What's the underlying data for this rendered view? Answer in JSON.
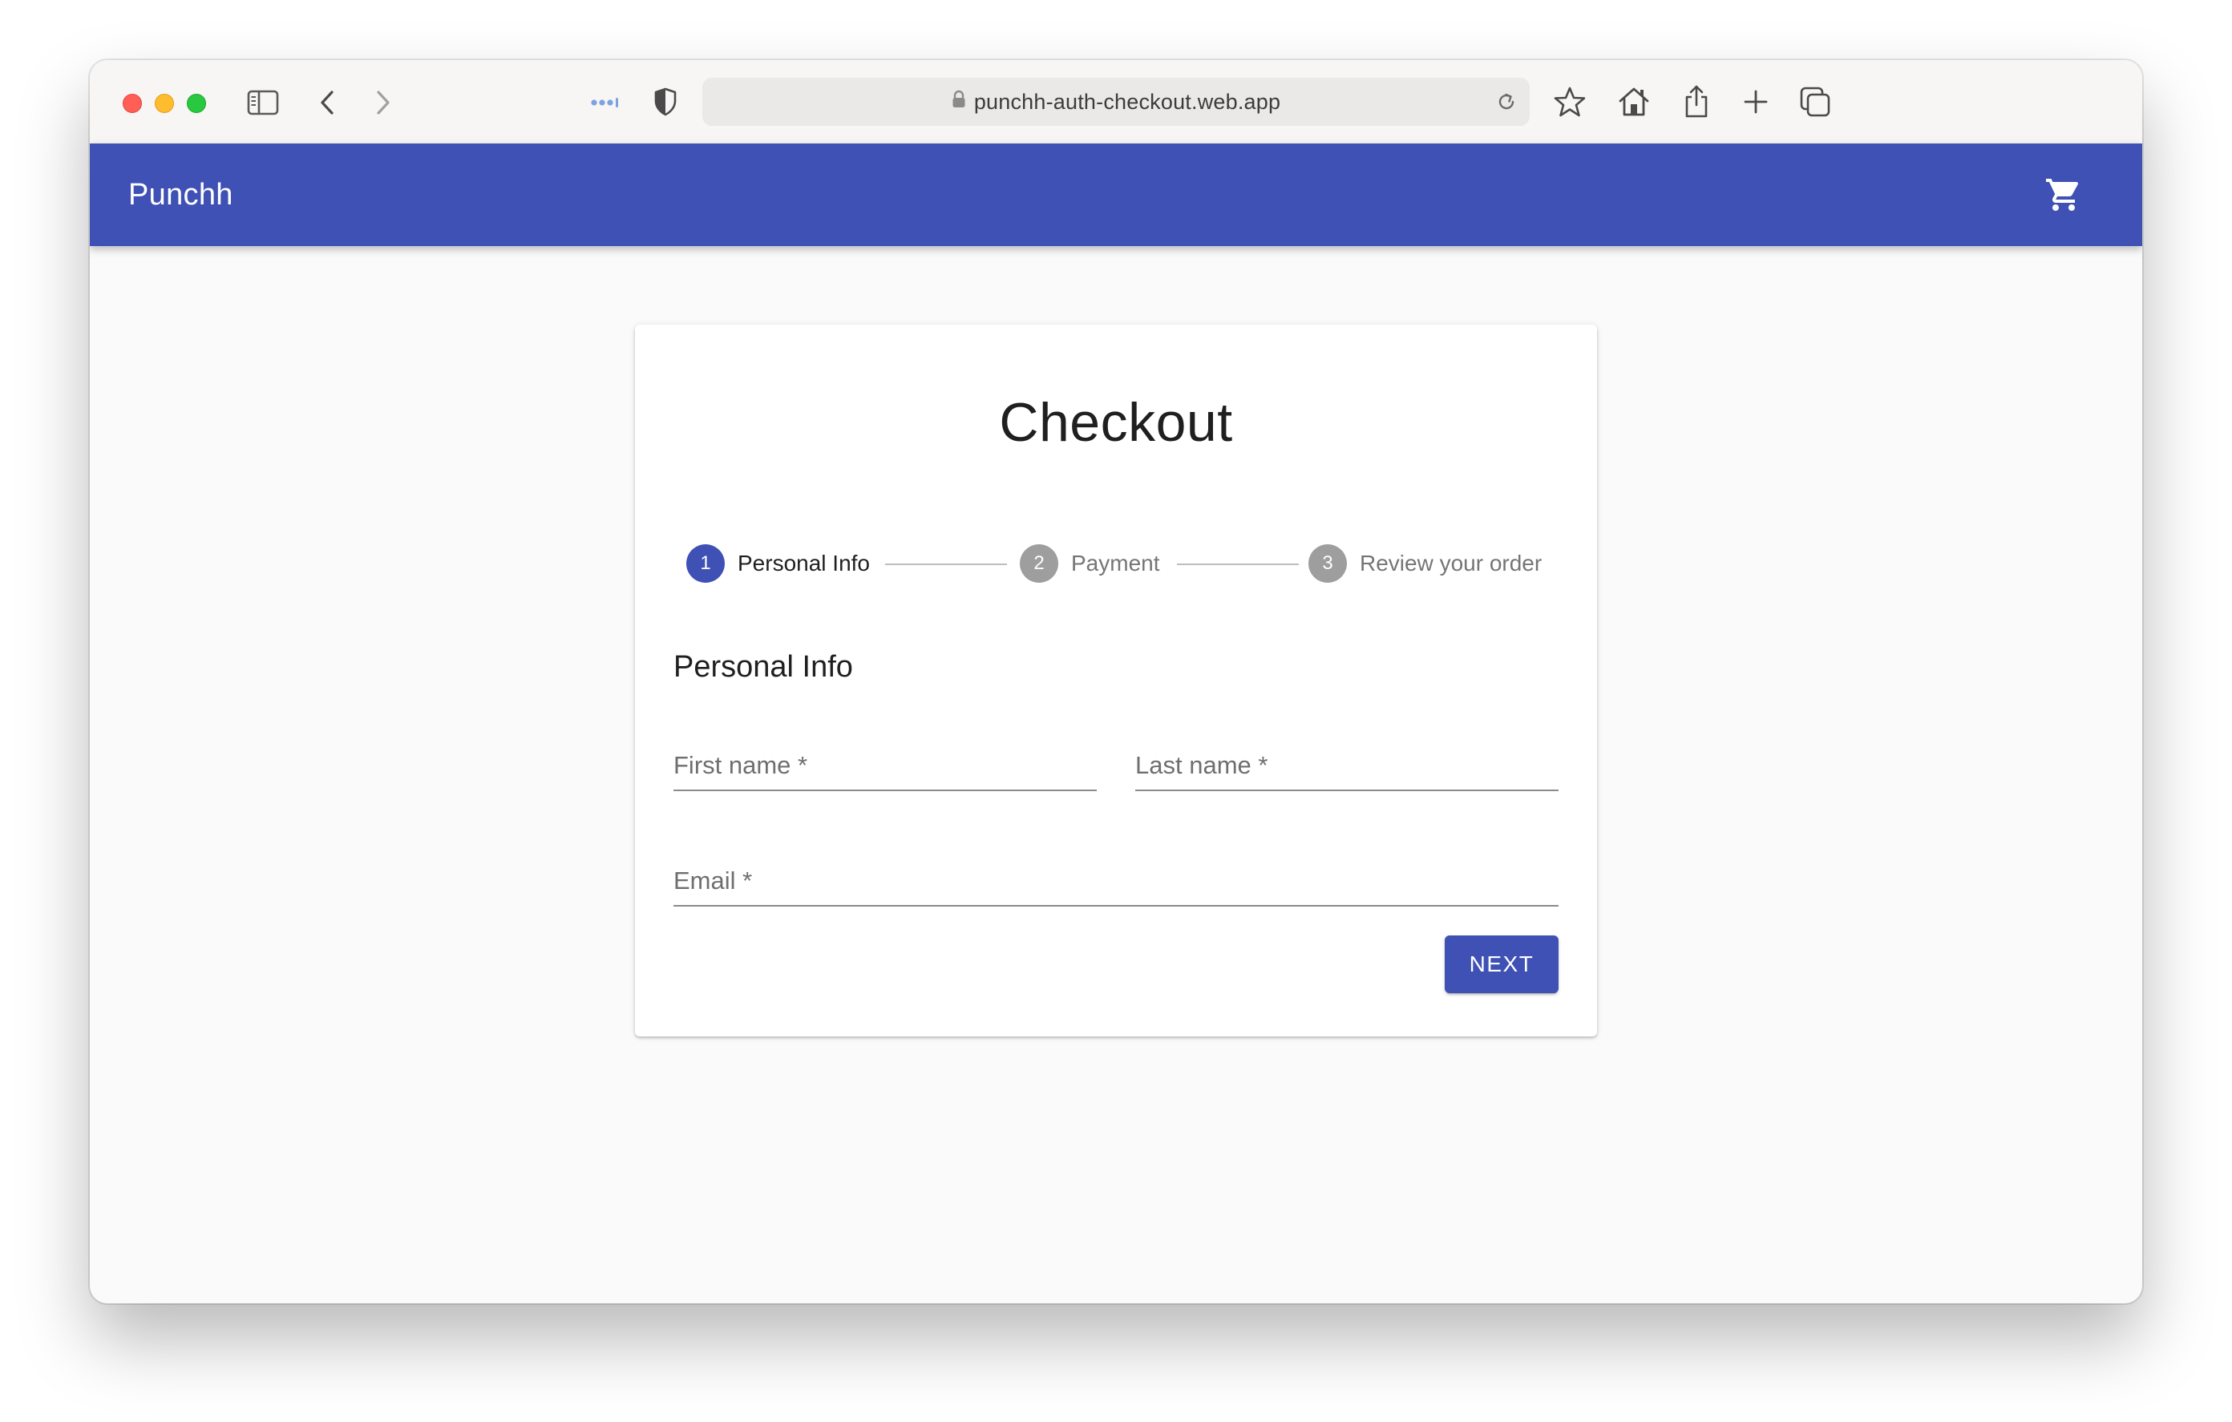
{
  "browser": {
    "url": "punchh-auth-checkout.web.app",
    "icons": [
      "sidebar-icon",
      "back-icon",
      "forward-icon",
      "tab-dots-icon",
      "shield-icon",
      "lock-icon",
      "reload-icon",
      "star-icon",
      "home-icon",
      "share-icon",
      "plus-icon",
      "tabs-icon"
    ]
  },
  "app_bar": {
    "title": "Punchh",
    "cart_icon": "shopping-cart-icon",
    "background": "#3f51b5"
  },
  "checkout": {
    "title": "Checkout",
    "steps": [
      {
        "number": "1",
        "label": "Personal Info",
        "state": "active"
      },
      {
        "number": "2",
        "label": "Payment",
        "state": "inactive"
      },
      {
        "number": "3",
        "label": "Review your order",
        "state": "inactive"
      }
    ],
    "section_title": "Personal Info",
    "fields": {
      "first_name": {
        "label": "First name *",
        "value": ""
      },
      "last_name": {
        "label": "Last name *",
        "value": ""
      },
      "email": {
        "label": "Email *",
        "value": ""
      }
    },
    "next_button": "NEXT"
  },
  "colors": {
    "primary": "#3f51b5",
    "inactive_step": "#9e9e9e",
    "page_background": "#fafafa"
  }
}
